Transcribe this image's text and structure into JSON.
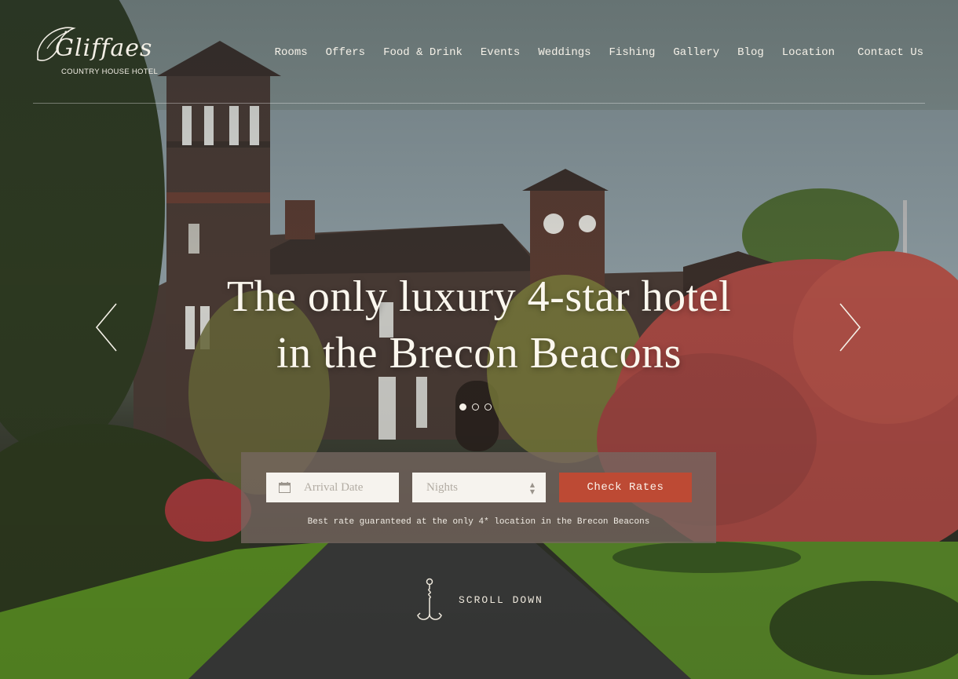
{
  "logo": {
    "script_text": "Gliffaes",
    "subtitle": "COUNTRY HOUSE HOTEL"
  },
  "nav": {
    "items": [
      {
        "label": "Rooms"
      },
      {
        "label": "Offers"
      },
      {
        "label": "Food & Drink"
      },
      {
        "label": "Events"
      },
      {
        "label": "Weddings"
      },
      {
        "label": "Fishing"
      },
      {
        "label": "Gallery"
      },
      {
        "label": "Blog"
      },
      {
        "label": "Location"
      },
      {
        "label": "Contact Us"
      }
    ]
  },
  "hero": {
    "headline_line1": "The only luxury 4-star hotel",
    "headline_line2": "in the Brecon Beacons",
    "slide_count": 3,
    "active_slide": 1
  },
  "booking": {
    "arrival_placeholder": "Arrival Date",
    "nights_placeholder": "Nights",
    "button_label": "Check Rates",
    "note": "Best rate guaranteed at the only 4* location in the Brecon Beacons"
  },
  "scroll": {
    "label": "SCROLL DOWN"
  },
  "colors": {
    "accent": "#bd4a34",
    "panel": "#766660",
    "text_light": "#f5f1e8"
  },
  "icons": {
    "calendar": "calendar-icon",
    "hook": "fishing-hook-icon",
    "prev": "chevron-left-icon",
    "next": "chevron-right-icon"
  }
}
